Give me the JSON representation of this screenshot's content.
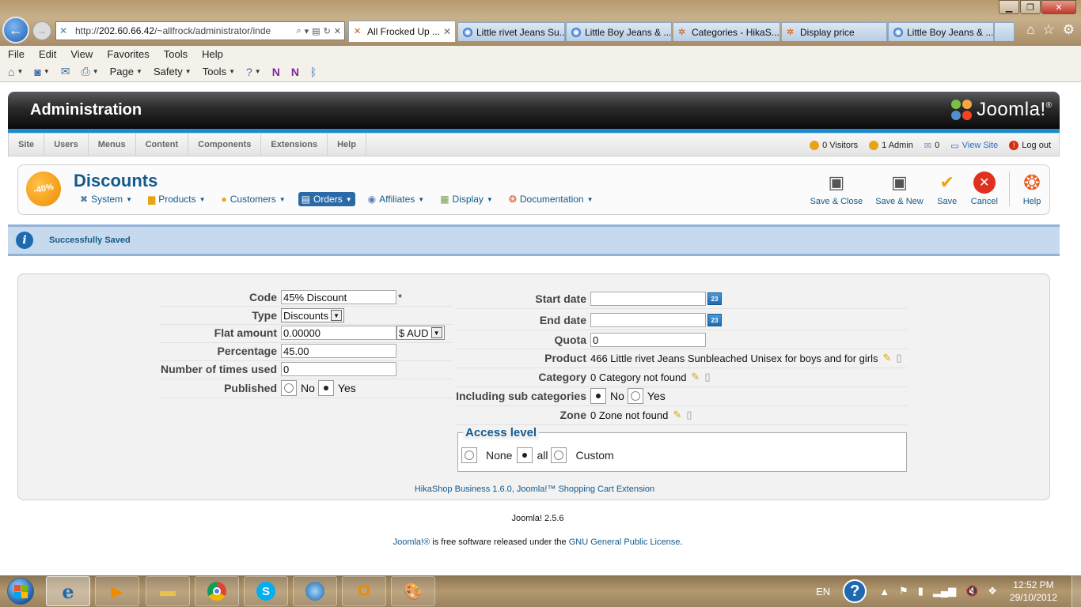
{
  "browser": {
    "address": "http://202.60.66.42/~allfrock/administrator/inde",
    "address_host": "202.60.66.42",
    "address_prefix": "http://",
    "address_path": "/~allfrock/administrator/inde",
    "tabs": [
      {
        "label": "All Frocked Up ...",
        "active": true
      },
      {
        "label": "Little rivet Jeans Su..."
      },
      {
        "label": "Little Boy Jeans & ..."
      },
      {
        "label": "Categories - HikaS..."
      },
      {
        "label": "Display price"
      },
      {
        "label": "Little Boy Jeans & ..."
      }
    ],
    "menu": [
      "File",
      "Edit",
      "View",
      "Favorites",
      "Tools",
      "Help"
    ],
    "commands": [
      "Page",
      "Safety",
      "Tools"
    ]
  },
  "admin": {
    "title": "Administration",
    "logo": "Joomla!",
    "logo_mark": "®",
    "menu": [
      "Site",
      "Users",
      "Menus",
      "Content",
      "Components",
      "Extensions",
      "Help"
    ],
    "status": {
      "visitors": "0 Visitors",
      "admins": "1 Admin",
      "messages": "0",
      "view_site": "View Site",
      "logout": "Log out"
    }
  },
  "toolbar": {
    "badge": "-40%",
    "page_title": "Discounts",
    "hika_menu": [
      {
        "label": "System",
        "icon": "wrench-icon"
      },
      {
        "label": "Products",
        "icon": "box-icon"
      },
      {
        "label": "Customers",
        "icon": "users-icon"
      },
      {
        "label": "Orders",
        "icon": "orders-icon"
      },
      {
        "label": "Affiliates",
        "icon": "affiliates-icon"
      },
      {
        "label": "Display",
        "icon": "display-icon"
      },
      {
        "label": "Documentation",
        "icon": "lifebuoy-icon"
      }
    ],
    "actions": {
      "save_close": "Save & Close",
      "save_new": "Save & New",
      "save": "Save",
      "cancel": "Cancel",
      "help": "Help"
    }
  },
  "message": "Successfully Saved",
  "form": {
    "left": {
      "code_label": "Code",
      "code_value": "45% Discount",
      "required_mark": "*",
      "type_label": "Type",
      "type_value": "Discounts",
      "flat_label": "Flat amount",
      "flat_value": "0.00000",
      "currency": "$ AUD",
      "percentage_label": "Percentage",
      "percentage_value": "45.00",
      "times_label": "Number of times used",
      "times_value": "0",
      "published_label": "Published",
      "published_no": "No",
      "published_yes": "Yes"
    },
    "right": {
      "start_label": "Start date",
      "start_value": "",
      "end_label": "End date",
      "end_value": "",
      "calendar": "23",
      "quota_label": "Quota",
      "quota_value": "0",
      "product_label": "Product",
      "product_value": "466 Little rivet Jeans Sunbleached Unisex for boys and for girls",
      "category_label": "Category",
      "category_value": "0 Category not found",
      "subcat_label": "Including sub categories",
      "subcat_no": "No",
      "subcat_yes": "Yes",
      "zone_label": "Zone",
      "zone_value": "0 Zone not found"
    },
    "access": {
      "legend": "Access level",
      "none": "None",
      "all": "all",
      "custom": "Custom"
    },
    "footer": "HikaShop Business 1.6.0, Joomla!™ Shopping Cart Extension"
  },
  "page_footer": {
    "version": "Joomla! 2.5.6",
    "license_link1": "Joomla!®",
    "license_mid": " is free software released under the ",
    "license_link2": "GNU General Public License",
    "license_end": "."
  },
  "taskbar": {
    "lang": "EN",
    "time": "12:52 PM",
    "date": "29/10/2012"
  }
}
